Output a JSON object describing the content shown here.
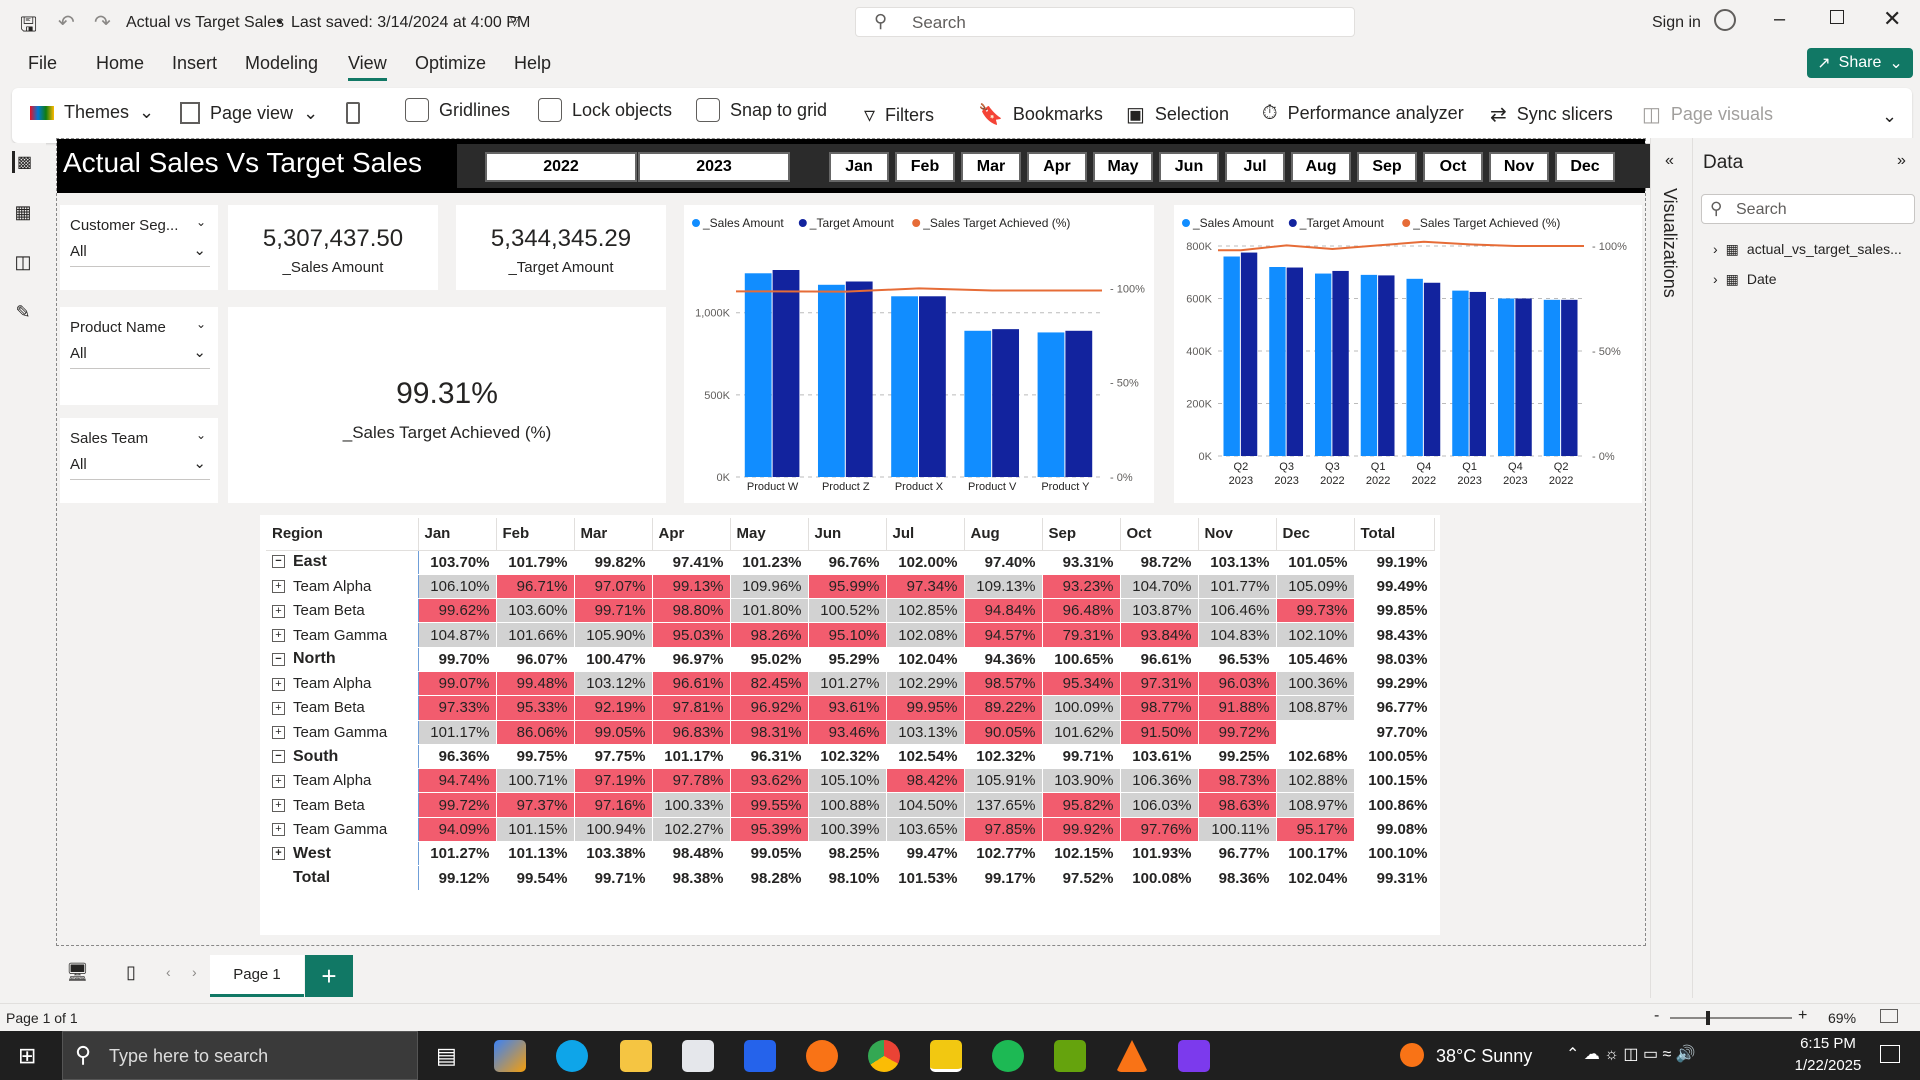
{
  "window": {
    "title": "Actual vs Target Sales",
    "saved": "Last saved: 3/14/2024 at 4:00 PM",
    "search_placeholder": "Search",
    "signin": "Sign in"
  },
  "menu": [
    "File",
    "Home",
    "Insert",
    "Modeling",
    "View",
    "Optimize",
    "Help"
  ],
  "share_label": "Share",
  "ribbon": {
    "themes": "Themes",
    "page_view": "Page view",
    "gridlines": "Gridlines",
    "lock_objects": "Lock objects",
    "snap_to_grid": "Snap to grid",
    "filters": "Filters",
    "bookmarks": "Bookmarks",
    "selection": "Selection",
    "performance": "Performance analyzer",
    "sync_slicers": "Sync slicers",
    "page_visuals": "Page visuals"
  },
  "report": {
    "title": "Actual Sales Vs Target Sales",
    "years": [
      "2022",
      "2023"
    ],
    "months": [
      "Jan",
      "Feb",
      "Mar",
      "Apr",
      "May",
      "Jun",
      "Jul",
      "Aug",
      "Sep",
      "Oct",
      "Nov",
      "Dec"
    ],
    "slicers": [
      {
        "label": "Customer Seg...",
        "value": "All"
      },
      {
        "label": "Product Name",
        "value": "All"
      },
      {
        "label": "Sales Team",
        "value": "All"
      }
    ],
    "kpi": {
      "sales_value": "5,307,437.50",
      "sales_label": "_Sales Amount",
      "target_value": "5,344,345.29",
      "target_label": "_Target Amount",
      "achieved_value": "99.31%",
      "achieved_label": "_Sales Target Achieved (%)"
    }
  },
  "chart_data": [
    {
      "type": "bar",
      "legend": [
        "_Sales Amount",
        "_Target Amount",
        "_Sales Target Achieved (%)"
      ],
      "categories": [
        "Product W",
        "Product Z",
        "Product X",
        "Product V",
        "Product Y"
      ],
      "series": [
        {
          "name": "_Sales Amount",
          "values": [
            1240000,
            1170000,
            1100000,
            890000,
            880000
          ]
        },
        {
          "name": "_Target Amount",
          "values": [
            1260000,
            1190000,
            1100000,
            900000,
            890000
          ]
        },
        {
          "name": "_Sales Target Achieved (%)",
          "values": [
            98.4,
            98.3,
            100,
            98.9,
            98.9
          ]
        }
      ],
      "yticks": [
        "0K",
        "500K",
        "1,000K"
      ],
      "ylim": [
        0,
        1400000
      ],
      "y2ticks": [
        "0%",
        "50%",
        "100%"
      ],
      "y2lim": [
        0,
        100
      ],
      "colors": [
        "#118dff",
        "#12239e",
        "#e66c37"
      ]
    },
    {
      "type": "bar",
      "legend": [
        "_Sales Amount",
        "_Target Amount",
        "_Sales Target Achieved (%)"
      ],
      "categories": [
        "Q2 2023",
        "Q3 2023",
        "Q3 2022",
        "Q1 2022",
        "Q4 2022",
        "Q1 2023",
        "Q4 2023",
        "Q2 2022"
      ],
      "cat_line1": [
        "Q2",
        "Q3",
        "Q3",
        "Q1",
        "Q4",
        "Q1",
        "Q4",
        "Q2"
      ],
      "cat_line2": [
        "2023",
        "2023",
        "2022",
        "2022",
        "2022",
        "2023",
        "2023",
        "2022"
      ],
      "series": [
        {
          "name": "_Sales Amount",
          "values": [
            760000,
            720000,
            695000,
            690000,
            675000,
            630000,
            600000,
            595000
          ]
        },
        {
          "name": "_Target Amount",
          "values": [
            775000,
            718000,
            705000,
            688000,
            660000,
            625000,
            600000,
            595000
          ]
        },
        {
          "name": "_Sales Target Achieved (%)",
          "values": [
            98,
            100.3,
            98.6,
            100.3,
            102,
            100.8,
            100,
            100
          ]
        }
      ],
      "yticks": [
        "0K",
        "200K",
        "400K",
        "600K",
        "800K"
      ],
      "ylim": [
        0,
        800000
      ],
      "y2ticks": [
        "0%",
        "50%",
        "100%"
      ],
      "y2lim": [
        0,
        100
      ],
      "colors": [
        "#118dff",
        "#12239e",
        "#e66c37"
      ]
    }
  ],
  "matrix": {
    "headers": [
      "Region",
      "Jan",
      "Feb",
      "Mar",
      "Apr",
      "May",
      "Jun",
      "Jul",
      "Aug",
      "Sep",
      "Oct",
      "Nov",
      "Dec",
      "Total"
    ],
    "rows": [
      {
        "label": "East",
        "level": 0,
        "exp": "−",
        "values": [
          "103.70%",
          "101.79%",
          "99.82%",
          "97.41%",
          "101.23%",
          "96.76%",
          "102.00%",
          "97.40%",
          "93.31%",
          "98.72%",
          "103.13%",
          "101.05%",
          "99.19%"
        ]
      },
      {
        "label": "Team Alpha",
        "level": 1,
        "exp": "+",
        "values": [
          "106.10%",
          "96.71%",
          "97.07%",
          "99.13%",
          "109.96%",
          "95.99%",
          "97.34%",
          "109.13%",
          "93.23%",
          "104.70%",
          "101.77%",
          "105.09%",
          "99.49%"
        ]
      },
      {
        "label": "Team Beta",
        "level": 1,
        "exp": "+",
        "values": [
          "99.62%",
          "103.60%",
          "99.71%",
          "98.80%",
          "101.80%",
          "100.52%",
          "102.85%",
          "94.84%",
          "96.48%",
          "103.87%",
          "106.46%",
          "99.73%",
          "99.85%"
        ]
      },
      {
        "label": "Team Gamma",
        "level": 1,
        "exp": "+",
        "values": [
          "104.87%",
          "101.66%",
          "105.90%",
          "95.03%",
          "98.26%",
          "95.10%",
          "102.08%",
          "94.57%",
          "79.31%",
          "93.84%",
          "104.83%",
          "102.10%",
          "98.43%"
        ]
      },
      {
        "label": "North",
        "level": 0,
        "exp": "−",
        "values": [
          "99.70%",
          "96.07%",
          "100.47%",
          "96.97%",
          "95.02%",
          "95.29%",
          "102.04%",
          "94.36%",
          "100.65%",
          "96.61%",
          "96.53%",
          "105.46%",
          "98.03%"
        ]
      },
      {
        "label": "Team Alpha",
        "level": 1,
        "exp": "+",
        "values": [
          "99.07%",
          "99.48%",
          "103.12%",
          "96.61%",
          "82.45%",
          "101.27%",
          "102.29%",
          "98.57%",
          "95.34%",
          "97.31%",
          "96.03%",
          "100.36%",
          "99.29%"
        ]
      },
      {
        "label": "Team Beta",
        "level": 1,
        "exp": "+",
        "values": [
          "97.33%",
          "95.33%",
          "92.19%",
          "97.81%",
          "96.92%",
          "93.61%",
          "99.95%",
          "89.22%",
          "100.09%",
          "98.77%",
          "91.88%",
          "108.87%",
          "96.77%"
        ]
      },
      {
        "label": "Team Gamma",
        "level": 1,
        "exp": "+",
        "values": [
          "101.17%",
          "86.06%",
          "99.05%",
          "96.83%",
          "98.31%",
          "93.46%",
          "103.13%",
          "90.05%",
          "101.62%",
          "91.50%",
          "99.72%",
          "",
          "97.70%"
        ]
      },
      {
        "label": "South",
        "level": 0,
        "exp": "−",
        "values": [
          "96.36%",
          "99.75%",
          "97.75%",
          "101.17%",
          "96.31%",
          "102.32%",
          "102.54%",
          "102.32%",
          "99.71%",
          "103.61%",
          "99.25%",
          "102.68%",
          "100.05%"
        ]
      },
      {
        "label": "Team Alpha",
        "level": 1,
        "exp": "+",
        "values": [
          "94.74%",
          "100.71%",
          "97.19%",
          "97.78%",
          "93.62%",
          "105.10%",
          "98.42%",
          "105.91%",
          "103.90%",
          "106.36%",
          "98.73%",
          "102.88%",
          "100.15%"
        ]
      },
      {
        "label": "Team Beta",
        "level": 1,
        "exp": "+",
        "values": [
          "99.72%",
          "97.37%",
          "97.16%",
          "100.33%",
          "99.55%",
          "100.88%",
          "104.50%",
          "137.65%",
          "95.82%",
          "106.03%",
          "98.63%",
          "108.97%",
          "100.86%"
        ]
      },
      {
        "label": "Team Gamma",
        "level": 1,
        "exp": "+",
        "values": [
          "94.09%",
          "101.15%",
          "100.94%",
          "102.27%",
          "95.39%",
          "100.39%",
          "103.65%",
          "97.85%",
          "99.92%",
          "97.76%",
          "100.11%",
          "95.17%",
          "99.08%"
        ]
      },
      {
        "label": "West",
        "level": 0,
        "exp": "+",
        "values": [
          "101.27%",
          "101.13%",
          "103.38%",
          "98.48%",
          "99.05%",
          "98.25%",
          "99.47%",
          "102.77%",
          "102.15%",
          "101.93%",
          "96.77%",
          "100.17%",
          "100.10%"
        ]
      },
      {
        "label": "Total",
        "level": 0,
        "exp": "",
        "values": [
          "99.12%",
          "99.54%",
          "99.71%",
          "98.38%",
          "98.28%",
          "98.10%",
          "101.53%",
          "99.17%",
          "97.52%",
          "100.08%",
          "98.36%",
          "102.04%",
          "99.31%"
        ]
      }
    ]
  },
  "panes": {
    "visualizations": "Visualizations",
    "data": "Data",
    "data_search": "Search",
    "fields": [
      "actual_vs_target_sales...",
      "Date"
    ]
  },
  "pages": {
    "tab": "Page 1",
    "status": "Page 1 of 1",
    "zoom": "69%"
  },
  "taskbar": {
    "search": "Type here to search",
    "weather": "38°C  Sunny",
    "time": "6:15 PM",
    "date": "1/22/2025"
  }
}
